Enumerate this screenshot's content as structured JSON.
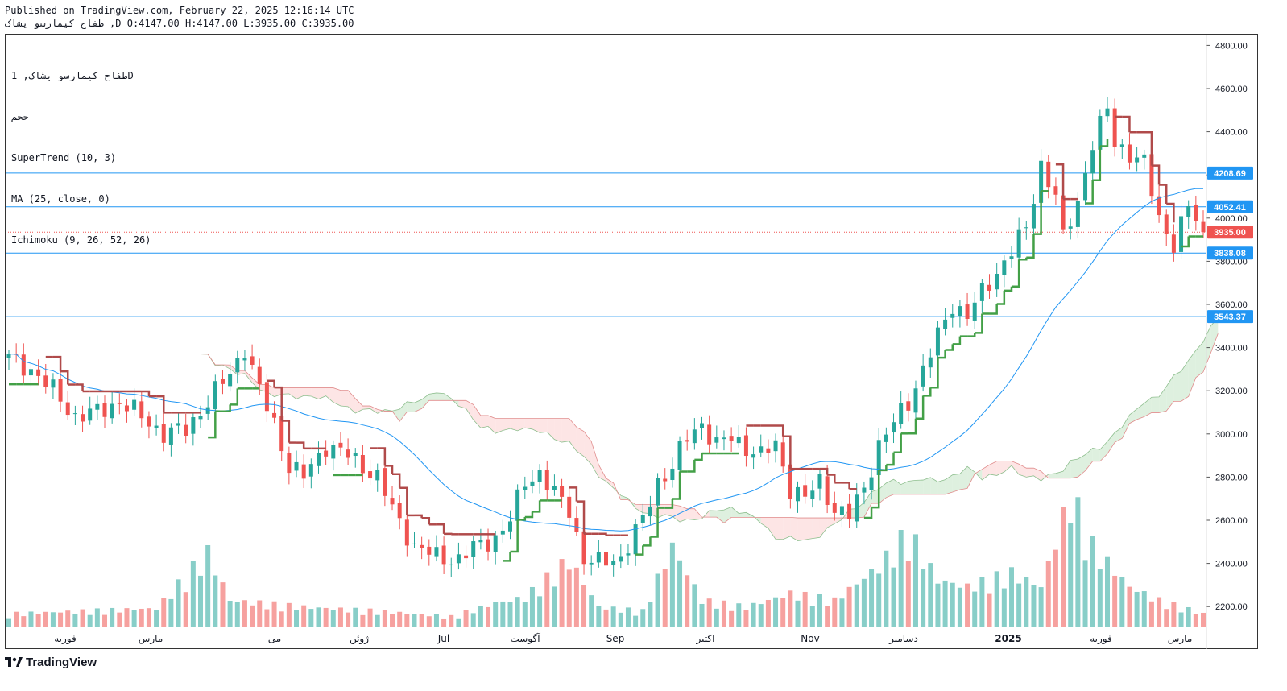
{
  "header": {
    "published": "Published on TradingView.com, February 22, 2025 12:16:14 UTC",
    "ohlc": "طفاح کیمارسو یشاک ,D O:4147.00 H:4147.00 L:3935.00 C:3935.00"
  },
  "legend": {
    "symbol": "طفاح کیمارسو یشاک, 1D",
    "exchange": "ححم",
    "indicator1": "SuperTrend (10, 3)",
    "indicator2": "MA (25, close, 0)",
    "indicator3": "Ichimoku (9, 26, 52, 26)"
  },
  "footer": {
    "brand": "TradingView"
  },
  "colors": {
    "up": "#26a69a",
    "down": "#ef5350",
    "st_up": "#43a047",
    "st_down": "#b04a4a",
    "ma": "#2196f3",
    "cloud_up": "#c8e6c9",
    "cloud_down": "#fcd3d3",
    "hline": "#2196f3",
    "last": "#ef5350"
  },
  "chart_data": {
    "type": "candlestick",
    "y_range": [
      2100,
      4850
    ],
    "y_ticks": [
      "4800.00",
      "4600.00",
      "4400.00",
      "4200.00",
      "4000.00",
      "3800.00",
      "3600.00",
      "3400.00",
      "3200.00",
      "3000.00",
      "2800.00",
      "2600.00",
      "2400.00",
      "2200.00"
    ],
    "x_ticks": [
      "فوریه",
      "مارس",
      "می",
      "ژوئن",
      "Jul",
      "آگوست",
      "Sep",
      "اکتبر",
      "Nov",
      "دسامبر",
      "2025",
      "فوریه",
      "مارس"
    ],
    "levels": [
      {
        "label": "4208.69",
        "value": 4208.69,
        "kind": "level"
      },
      {
        "label": "4052.41",
        "value": 4052.41,
        "kind": "level"
      },
      {
        "label": "3935.00",
        "value": 3935.0,
        "kind": "last"
      },
      {
        "label": "3838.08",
        "value": 3838.08,
        "kind": "level"
      },
      {
        "label": "3543.37",
        "value": 3543.37,
        "kind": "level"
      }
    ],
    "price_path": [
      [
        0,
        3350
      ],
      [
        3,
        3300
      ],
      [
        6,
        3200
      ],
      [
        9,
        3080
      ],
      [
        12,
        3100
      ],
      [
        15,
        3150
      ],
      [
        18,
        3080
      ],
      [
        21,
        3000
      ],
      [
        24,
        3020
      ],
      [
        27,
        3150
      ],
      [
        30,
        3280
      ],
      [
        32,
        3400
      ],
      [
        34,
        3200
      ],
      [
        36,
        3050
      ],
      [
        38,
        2850
      ],
      [
        40,
        2800
      ],
      [
        43,
        2950
      ],
      [
        46,
        2900
      ],
      [
        50,
        2800
      ],
      [
        52,
        2650
      ],
      [
        55,
        2480
      ],
      [
        58,
        2430
      ],
      [
        61,
        2420
      ],
      [
        63,
        2470
      ],
      [
        66,
        2520
      ],
      [
        68,
        2600
      ],
      [
        70,
        2780
      ],
      [
        72,
        2820
      ],
      [
        74,
        2720
      ],
      [
        76,
        2650
      ],
      [
        78,
        2420
      ],
      [
        80,
        2400
      ],
      [
        83,
        2430
      ],
      [
        86,
        2600
      ],
      [
        88,
        2780
      ],
      [
        90,
        2850
      ],
      [
        92,
        2980
      ],
      [
        94,
        3050
      ],
      [
        96,
        2950
      ],
      [
        98,
        2980
      ],
      [
        100,
        2940
      ],
      [
        102,
        2900
      ],
      [
        104,
        2950
      ],
      [
        106,
        2750
      ],
      [
        108,
        2700
      ],
      [
        110,
        2780
      ],
      [
        112,
        2650
      ],
      [
        114,
        2620
      ],
      [
        116,
        2750
      ],
      [
        118,
        2950
      ],
      [
        120,
        3050
      ],
      [
        122,
        3150
      ],
      [
        124,
        3300
      ],
      [
        126,
        3450
      ],
      [
        128,
        3600
      ],
      [
        130,
        3550
      ],
      [
        132,
        3650
      ],
      [
        134,
        3750
      ],
      [
        136,
        3850
      ],
      [
        138,
        3950
      ],
      [
        140,
        4250
      ],
      [
        142,
        4100
      ],
      [
        143,
        3900
      ],
      [
        145,
        4080
      ],
      [
        147,
        4350
      ],
      [
        149,
        4500
      ],
      [
        150,
        4350
      ],
      [
        152,
        4300
      ],
      [
        154,
        4250
      ],
      [
        156,
        4000
      ],
      [
        158,
        3880
      ],
      [
        160,
        4050
      ],
      [
        162,
        3935
      ]
    ],
    "volume_path": [
      [
        0,
        0.1
      ],
      [
        10,
        0.12
      ],
      [
        20,
        0.14
      ],
      [
        27,
        0.55
      ],
      [
        30,
        0.2
      ],
      [
        40,
        0.15
      ],
      [
        50,
        0.12
      ],
      [
        60,
        0.08
      ],
      [
        66,
        0.18
      ],
      [
        70,
        0.22
      ],
      [
        76,
        0.5
      ],
      [
        80,
        0.15
      ],
      [
        86,
        0.12
      ],
      [
        90,
        0.6
      ],
      [
        94,
        0.2
      ],
      [
        100,
        0.15
      ],
      [
        106,
        0.25
      ],
      [
        112,
        0.2
      ],
      [
        118,
        0.45
      ],
      [
        122,
        0.7
      ],
      [
        126,
        0.35
      ],
      [
        130,
        0.3
      ],
      [
        136,
        0.4
      ],
      [
        140,
        0.3
      ],
      [
        144,
        0.98
      ],
      [
        147,
        0.6
      ],
      [
        152,
        0.3
      ],
      [
        156,
        0.2
      ],
      [
        162,
        0.1
      ]
    ],
    "series": [
      {
        "name": "SuperTrend (10, 3)"
      },
      {
        "name": "MA (25, close, 0)"
      },
      {
        "name": "Ichimoku (9, 26, 52, 26)"
      }
    ]
  }
}
